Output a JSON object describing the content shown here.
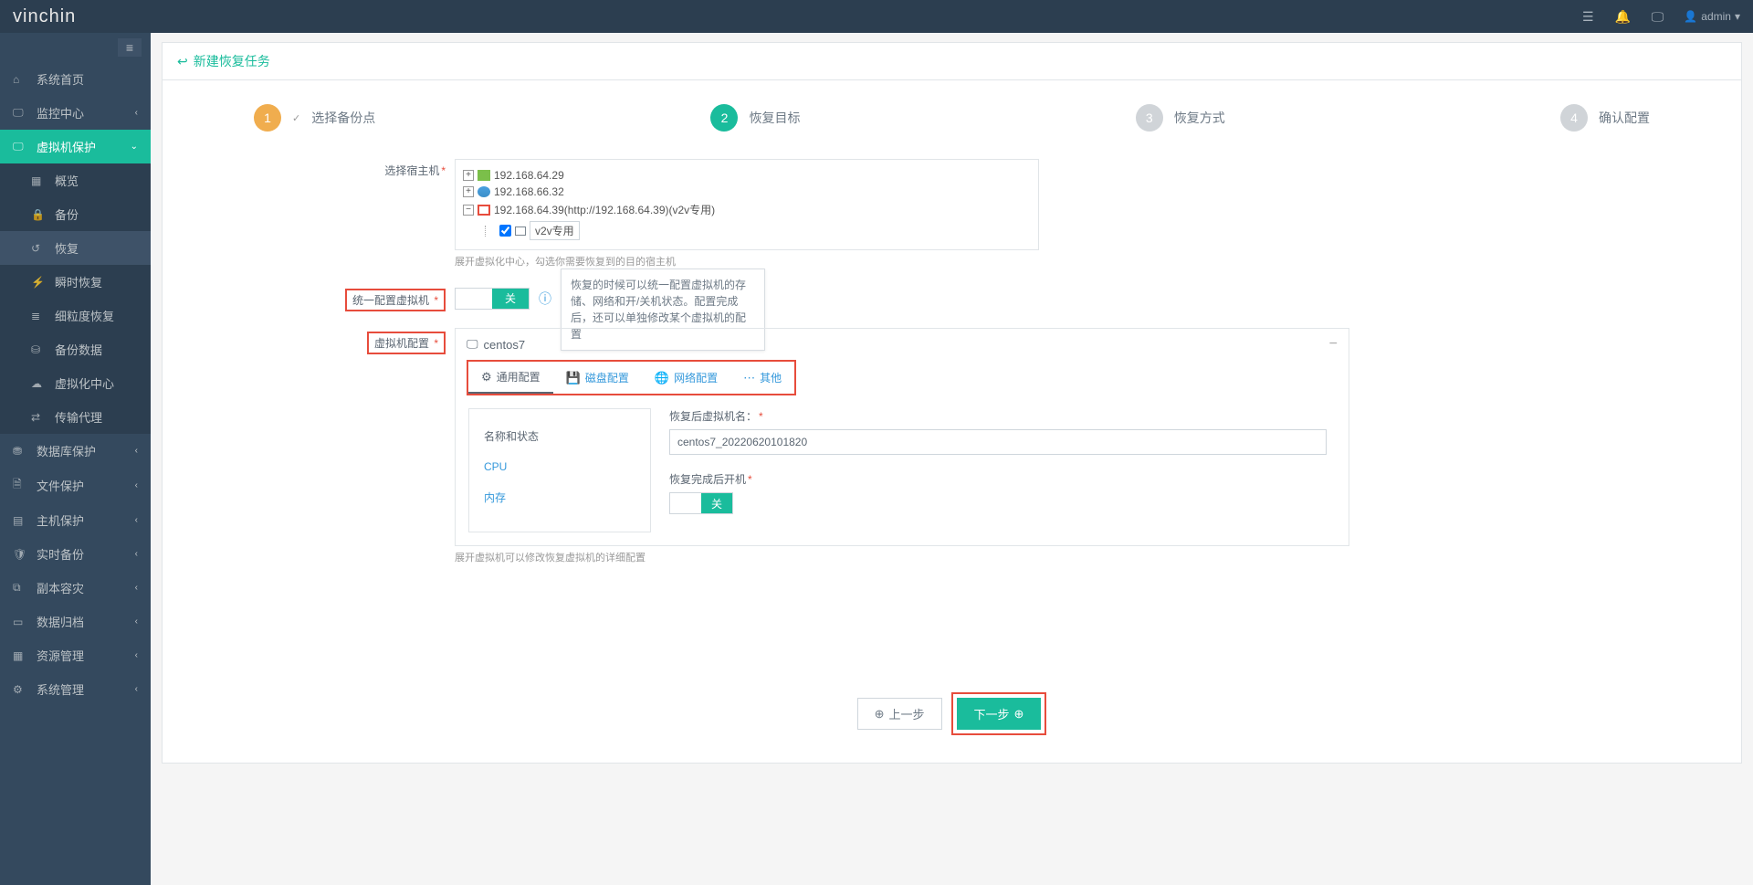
{
  "header": {
    "logo": "vinchin",
    "user": "admin"
  },
  "sidebar": {
    "items": [
      {
        "label": "系统首页"
      },
      {
        "label": "监控中心"
      },
      {
        "label": "虚拟机保护"
      },
      {
        "label": "概览"
      },
      {
        "label": "备份"
      },
      {
        "label": "恢复"
      },
      {
        "label": "瞬时恢复"
      },
      {
        "label": "细粒度恢复"
      },
      {
        "label": "备份数据"
      },
      {
        "label": "虚拟化中心"
      },
      {
        "label": "传输代理"
      },
      {
        "label": "数据库保护"
      },
      {
        "label": "文件保护"
      },
      {
        "label": "主机保护"
      },
      {
        "label": "实时备份"
      },
      {
        "label": "副本容灾"
      },
      {
        "label": "数据归档"
      },
      {
        "label": "资源管理"
      },
      {
        "label": "系统管理"
      }
    ]
  },
  "page": {
    "title": "新建恢复任务",
    "steps": [
      {
        "num": "1",
        "label": "选择备份点"
      },
      {
        "num": "2",
        "label": "恢复目标"
      },
      {
        "num": "3",
        "label": "恢复方式"
      },
      {
        "num": "4",
        "label": "确认配置"
      }
    ],
    "select_host_label": "选择宿主机",
    "tree": {
      "n1": "192.168.64.29",
      "n2": "192.168.66.32",
      "n3": "192.168.64.39(http://192.168.64.39)(v2v专用)",
      "n4": "v2v专用"
    },
    "tree_hint": "展开虚拟化中心，勾选你需要恢复到的目的宿主机",
    "uniform_label": "统一配置虚拟机",
    "toggle_off": "关",
    "tooltip": "恢复的时候可以统一配置虚拟机的存储、网络和开/关机状态。配置完成后，还可以单独修改某个虚拟机的配置",
    "vm_config_label": "虚拟机配置",
    "vm_name": "centos7",
    "tabs": {
      "general": "通用配置",
      "disk": "磁盘配置",
      "network": "网络配置",
      "other": "其他"
    },
    "sideitems": {
      "name": "名称和状态",
      "cpu": "CPU",
      "mem": "内存"
    },
    "field_vm_name": "恢复后虚拟机名：",
    "vm_name_value": "centos7_20220620101820",
    "field_poweron": "恢复完成后开机",
    "vm_hint": "展开虚拟机可以修改恢复虚拟机的详细配置",
    "btn_prev": "上一步",
    "btn_next": "下一步"
  }
}
